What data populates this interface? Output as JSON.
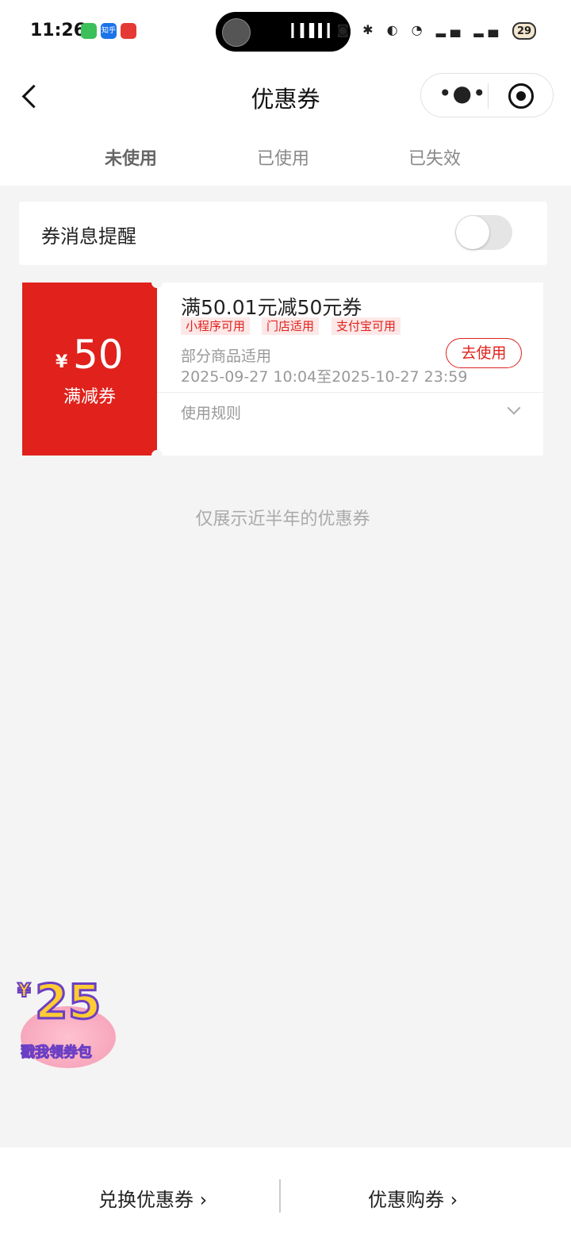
{
  "status_bar": {
    "time": "11:26",
    "apps": [
      "app-green",
      "知乎",
      "app-red"
    ],
    "icons": [
      "panda-icon",
      "bluetooth-icon",
      "battery-saver-icon",
      "wifi-icon",
      "5g-signal-icon",
      "4g-signal-icon"
    ],
    "battery": "29"
  },
  "nav": {
    "title": "优惠券"
  },
  "tabs": [
    {
      "label": "未使用",
      "active": true
    },
    {
      "label": "已使用",
      "active": false
    },
    {
      "label": "已失效",
      "active": false
    }
  ],
  "reminder": {
    "label": "券消息提醒",
    "enabled": false
  },
  "coupon": {
    "currency": "¥",
    "amount": "50",
    "type": "满减券",
    "title": "满50.01元减50元券",
    "tags": [
      "小程序可用",
      "门店适用",
      "支付宝可用"
    ],
    "scope": "部分商品适用",
    "valid": "2025-09-27 10:04至2025-10-27 23:59",
    "use_label": "去使用",
    "rules_label": "使用规则"
  },
  "notice": "仅展示近半年的优惠券",
  "promo": {
    "currency": "¥",
    "amount": "25",
    "text": "戳我领券包"
  },
  "bottom": {
    "redeem": "兑换优惠券 ›",
    "buy": "优惠购券 ›"
  },
  "colors": {
    "accent": "#e0211c",
    "background": "#f4f4f4"
  }
}
